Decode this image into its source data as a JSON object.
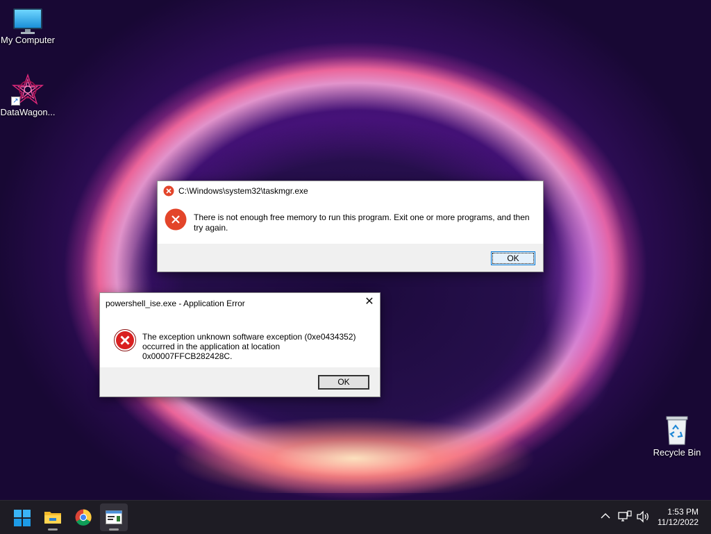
{
  "desktop": {
    "icons": [
      {
        "label": "My Computer",
        "icon": "monitor-icon"
      },
      {
        "label": "DataWagon...",
        "icon": "datawagon-app-icon"
      },
      {
        "label": "Recycle Bin",
        "icon": "recycle-bin-icon"
      }
    ]
  },
  "dialogs": {
    "taskmgr": {
      "title": "C:\\Windows\\system32\\taskmgr.exe",
      "message_line1": "There is not enough free memory to run this program. Exit one or more programs, and then",
      "message_line2": "try again.",
      "ok_label": "OK",
      "icon": "error-icon"
    },
    "powershell": {
      "title": "powershell_ise.exe - Application Error",
      "message_line1": "The exception unknown software exception (0xe0434352)",
      "message_line2": "occurred in the application at location 0x00007FFCB282428C.",
      "ok_label": "OK",
      "icon": "error-icon",
      "close_glyph": "✕"
    }
  },
  "taskbar": {
    "apps": [
      {
        "name": "start-button",
        "icon": "windows-logo-icon"
      },
      {
        "name": "file-explorer",
        "icon": "folder-icon"
      },
      {
        "name": "chrome",
        "icon": "chrome-icon"
      },
      {
        "name": "taskmgr-app",
        "icon": "app-window-icon"
      }
    ],
    "tray": {
      "chevron": "^",
      "time": "1:53 PM",
      "date": "11/12/2022"
    }
  },
  "colors": {
    "error_red": "#e3452a",
    "accent_blue": "#0078d7",
    "taskbar_bg": "#1e1c24"
  }
}
